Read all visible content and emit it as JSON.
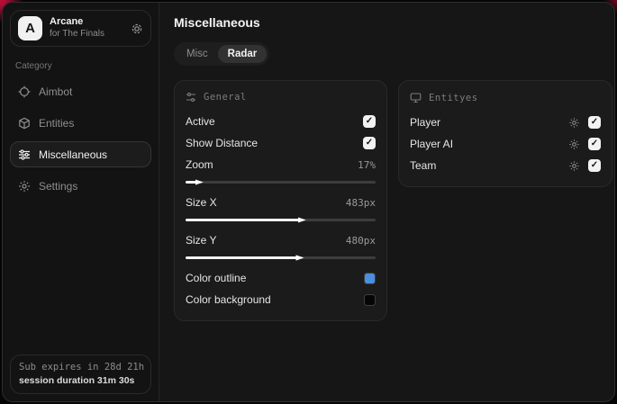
{
  "sidebar": {
    "app": {
      "initial": "A",
      "name": "Arcane",
      "subtitle": "for The Finals"
    },
    "category_label": "Category",
    "items": [
      {
        "label": "Aimbot",
        "icon": "crosshair-icon",
        "active": false
      },
      {
        "label": "Entities",
        "icon": "cube-icon",
        "active": false
      },
      {
        "label": "Miscellaneous",
        "icon": "sliders-icon",
        "active": true
      },
      {
        "label": "Settings",
        "icon": "gear-icon",
        "active": false
      }
    ],
    "footer": {
      "sub_expires": "Sub expires in 28d 21h",
      "session_duration": "session duration 31m 30s"
    }
  },
  "main": {
    "title": "Miscellaneous",
    "tabs": [
      {
        "label": "Misc",
        "active": false
      },
      {
        "label": "Radar",
        "active": true
      }
    ],
    "general_panel": {
      "title": "General",
      "icon": "sliders-mini-icon",
      "toggles": [
        {
          "label": "Active",
          "checked": true
        },
        {
          "label": "Show Distance",
          "checked": true
        }
      ],
      "sliders": [
        {
          "label": "Zoom",
          "value": "17%",
          "fill_pct": 6
        },
        {
          "label": "Size X",
          "value": "483px",
          "fill_pct": 60
        },
        {
          "label": "Size Y",
          "value": "480px",
          "fill_pct": 59
        }
      ],
      "colors": [
        {
          "label": "Color outline",
          "hex": "#4a8ee0"
        },
        {
          "label": "Color background",
          "hex": "#050505"
        }
      ]
    },
    "entities_panel": {
      "title": "Entityes",
      "icon": "monitor-icon",
      "items": [
        {
          "label": "Player",
          "checked": true
        },
        {
          "label": "Player AI",
          "checked": true
        },
        {
          "label": "Team",
          "checked": true
        }
      ]
    }
  },
  "colors": {
    "accent_red": "#d11140",
    "outline_blue": "#4a8ee0",
    "background_swatch": "#050505"
  }
}
